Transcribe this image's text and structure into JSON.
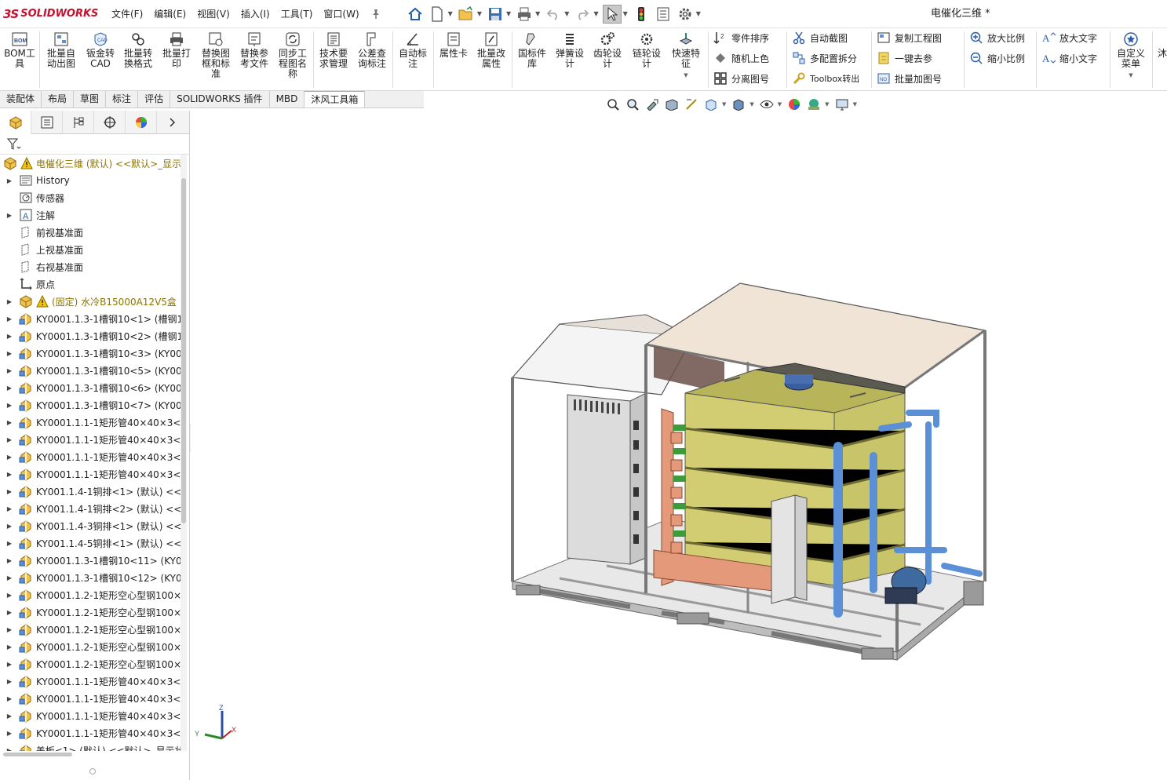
{
  "app": {
    "brand_prefix": "3S",
    "brand_name": "SOLIDWORKS",
    "document_title": "电催化三维 *"
  },
  "menus": [
    "文件(F)",
    "编辑(E)",
    "视图(V)",
    "插入(I)",
    "工具(T)",
    "窗口(W)"
  ],
  "ribbon": {
    "big": [
      {
        "id": "bom",
        "label": "BOM工具"
      },
      {
        "id": "batch-drawing",
        "label": "批量自动出图"
      },
      {
        "id": "sheet-cad",
        "label": "钣金转CAD"
      },
      {
        "id": "batch-convert",
        "label": "批量转换格式"
      },
      {
        "id": "batch-print",
        "label": "批量打印"
      },
      {
        "id": "replace-frame",
        "label": "替换图框和标准"
      },
      {
        "id": "replace-ref",
        "label": "替换参考文件"
      },
      {
        "id": "sync-name",
        "label": "同步工程图名称"
      },
      {
        "id": "tech-req",
        "label": "技术要求管理"
      },
      {
        "id": "tolerance",
        "label": "公差查询标注"
      },
      {
        "id": "auto-dim",
        "label": "自动标注"
      },
      {
        "id": "prop-card",
        "label": "属性卡"
      },
      {
        "id": "batch-prop",
        "label": "批量改属性"
      },
      {
        "id": "gb-lib",
        "label": "国标件库"
      },
      {
        "id": "spring",
        "label": "弹簧设计"
      },
      {
        "id": "gear",
        "label": "齿轮设计"
      },
      {
        "id": "chain",
        "label": "链轮设计"
      },
      {
        "id": "quick-feature",
        "label": "快速特征"
      },
      {
        "id": "custom-menu",
        "label": "自定义菜单"
      }
    ],
    "small": {
      "col1": [
        "零件排序",
        "随机上色",
        "分离图号"
      ],
      "col2": [
        "自动截图",
        "多配置拆分",
        "Toolbox转出"
      ],
      "col3": [
        "复制工程图",
        "一键去参",
        "批量加图号"
      ],
      "col4": [
        "放大比例",
        "缩小比例"
      ],
      "col5": [
        "放大文字",
        "缩小文字"
      ]
    },
    "overflow": "沐"
  },
  "tabs": [
    "装配体",
    "布局",
    "草图",
    "标注",
    "评估",
    "SOLIDWORKS 插件",
    "MBD",
    "沐风工具箱"
  ],
  "active_tab": "沐风工具箱",
  "tree": {
    "root": "电催化三维 (默认) <<默认>_显示",
    "items": [
      {
        "label": "History",
        "icon": "folder",
        "arrow": true
      },
      {
        "label": "传感器",
        "icon": "sensor",
        "arrow": false
      },
      {
        "label": "注解",
        "icon": "annotation",
        "arrow": true
      },
      {
        "label": "前视基准面",
        "icon": "plane",
        "arrow": false
      },
      {
        "label": "上视基准面",
        "icon": "plane",
        "arrow": false
      },
      {
        "label": "右视基准面",
        "icon": "plane",
        "arrow": false
      },
      {
        "label": "原点",
        "icon": "origin",
        "arrow": false
      },
      {
        "label": "(固定) 水冷B15000A12V5盒",
        "icon": "assembly",
        "arrow": true,
        "warn": true,
        "gold": true
      },
      {
        "label": "KY0001.1.3-1槽钢10<1> (槽钢1",
        "icon": "part",
        "arrow": true
      },
      {
        "label": "KY0001.1.3-1槽钢10<2> (槽钢1",
        "icon": "part",
        "arrow": true
      },
      {
        "label": "KY0001.1.3-1槽钢10<3> (KY00",
        "icon": "part",
        "arrow": true
      },
      {
        "label": "KY0001.1.3-1槽钢10<5> (KY00",
        "icon": "part",
        "arrow": true
      },
      {
        "label": "KY0001.1.3-1槽钢10<6> (KY00",
        "icon": "part",
        "arrow": true
      },
      {
        "label": "KY0001.1.3-1槽钢10<7> (KY00",
        "icon": "part",
        "arrow": true
      },
      {
        "label": "KY0001.1.1-1矩形管40×40×3<",
        "icon": "part",
        "arrow": true
      },
      {
        "label": "KY0001.1.1-1矩形管40×40×3<",
        "icon": "part",
        "arrow": true
      },
      {
        "label": "KY0001.1.1-1矩形管40×40×3<",
        "icon": "part",
        "arrow": true
      },
      {
        "label": "KY0001.1.1-1矩形管40×40×3<",
        "icon": "part",
        "arrow": true
      },
      {
        "label": "KY001.1.4-1铜排<1> (默认) <<",
        "icon": "part",
        "arrow": true
      },
      {
        "label": "KY001.1.4-1铜排<2> (默认) <<",
        "icon": "part",
        "arrow": true
      },
      {
        "label": "KY001.1.4-3铜排<1> (默认) <<",
        "icon": "part",
        "arrow": true
      },
      {
        "label": "KY001.1.4-5铜排<1> (默认) <<",
        "icon": "part",
        "arrow": true
      },
      {
        "label": "KY0001.1.3-1槽钢10<11> (KY0",
        "icon": "part",
        "arrow": true
      },
      {
        "label": "KY0001.1.3-1槽钢10<12> (KY0",
        "icon": "part",
        "arrow": true
      },
      {
        "label": "KY0001.1.2-1矩形空心型钢100×",
        "icon": "part",
        "arrow": true
      },
      {
        "label": "KY0001.1.2-1矩形空心型钢100×",
        "icon": "part",
        "arrow": true
      },
      {
        "label": "KY0001.1.2-1矩形空心型钢100×",
        "icon": "part",
        "arrow": true
      },
      {
        "label": "KY0001.1.2-1矩形空心型钢100×",
        "icon": "part",
        "arrow": true
      },
      {
        "label": "KY0001.1.2-1矩形空心型钢100×",
        "icon": "part",
        "arrow": true
      },
      {
        "label": "KY0001.1.1-1矩形管40×40×3<",
        "icon": "part",
        "arrow": true
      },
      {
        "label": "KY0001.1.1-1矩形管40×40×3<",
        "icon": "part",
        "arrow": true
      },
      {
        "label": "KY0001.1.1-1矩形管40×40×3<",
        "icon": "part",
        "arrow": true
      },
      {
        "label": "KY0001.1.1-1矩形管40×40×3<",
        "icon": "part",
        "arrow": true
      },
      {
        "label": "盖板<1> (默认) <<默认>_显示状",
        "icon": "part",
        "arrow": true
      }
    ]
  },
  "triad": {
    "x": "X",
    "y": "Y",
    "z": "Z"
  },
  "colors": {
    "brand": "#c8102e",
    "tank": "#c8c46a",
    "pipe": "#5b8fd6",
    "copper": "#e49a7a",
    "frame": "#b8b8b8",
    "roof": "#efe4d6"
  }
}
